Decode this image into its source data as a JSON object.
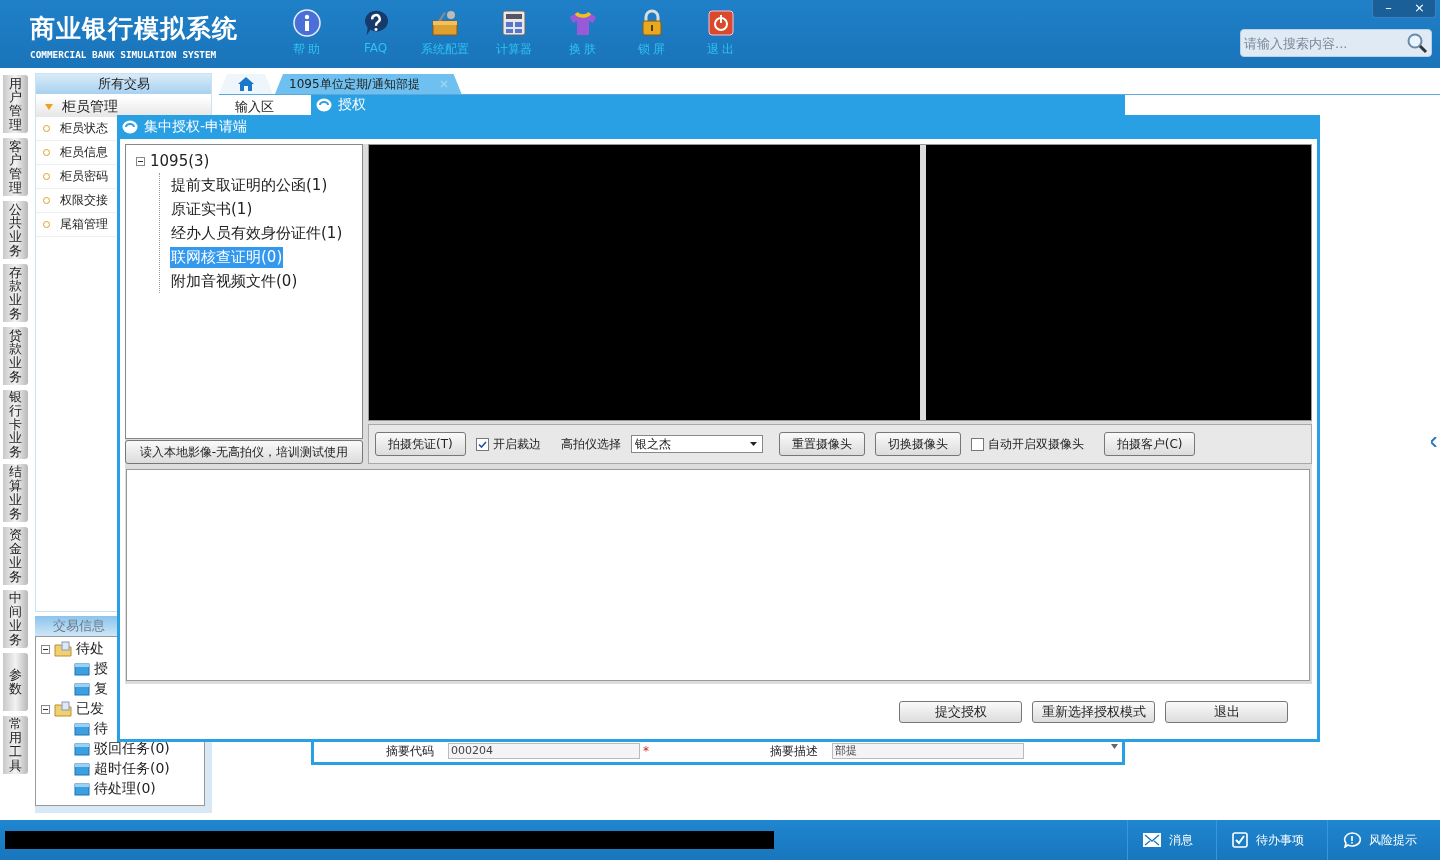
{
  "header": {
    "title": "商业银行模拟系统",
    "subtitle": "COMMERCIAL BANK SIMULATION SYSTEM",
    "tools": [
      {
        "label": "帮 助",
        "kind": "info"
      },
      {
        "label": "FAQ",
        "kind": "question"
      },
      {
        "label": "系统配置",
        "kind": "toolbox"
      },
      {
        "label": "计算器",
        "kind": "calculator"
      },
      {
        "label": "换 肤",
        "kind": "shirt"
      },
      {
        "label": "锁 屏",
        "kind": "lock"
      },
      {
        "label": "退 出",
        "kind": "power"
      }
    ],
    "window_controls": [
      "–",
      "×"
    ],
    "search": {
      "placeholder": "请输入搜索内容..."
    }
  },
  "side_tabs": [
    "用户管理",
    "客户管理",
    "公共业务",
    "存款业务",
    "贷款业务",
    "银行卡业务",
    "结算业务",
    "资金业务",
    "中间业务",
    "参数",
    "常用工具"
  ],
  "left_panel": {
    "title": "所有交易",
    "group": {
      "label": "柜员管理",
      "expanded": true
    },
    "items": [
      "柜员状态",
      "柜员信息",
      "柜员密码",
      "权限交接",
      "尾箱管理"
    ]
  },
  "info_panel": {
    "title": "交易信息",
    "tree": [
      {
        "label": "待处",
        "children": [
          {
            "label": "授"
          },
          {
            "label": "复"
          }
        ]
      },
      {
        "label": "已发",
        "children": [
          {
            "label": "待"
          },
          {
            "label": "驳回任务(0)"
          },
          {
            "label": "超时任务(0)"
          },
          {
            "label": "待处理(0)"
          }
        ]
      }
    ]
  },
  "main_tabs": [
    {
      "kind": "home",
      "selected": false
    },
    {
      "kind": "page",
      "label": "1095单位定期/通知部提",
      "selected": true
    }
  ],
  "back_dialog": {
    "title": "授权",
    "section": "输入区",
    "fields": [
      {
        "label": "摘要代码",
        "value": "000204",
        "mark": "*"
      },
      {
        "label": "摘要描述",
        "value": "部提"
      }
    ]
  },
  "front_dialog": {
    "title": "集中授权-申请端",
    "tree": {
      "label": "1095(3)",
      "expanded": true,
      "children": [
        {
          "label": "提前支取证明的公函(1)",
          "selected": false
        },
        {
          "label": "原证实书(1)",
          "selected": false
        },
        {
          "label": "经办人员有效身份证件(1)",
          "selected": false
        },
        {
          "label": "联网核查证明(0)",
          "selected": true
        },
        {
          "label": "附加音视频文件(0)",
          "selected": false
        }
      ]
    },
    "load_button": "读入本地影像-无高拍仪，培训测试使用",
    "toolbar": [
      {
        "kind": "button",
        "label": "拍摄凭证(T)"
      },
      {
        "kind": "checkbox",
        "label": "开启裁边",
        "checked": true
      },
      {
        "kind": "select",
        "label": "高拍仪选择",
        "value": "银之杰"
      },
      {
        "kind": "button",
        "label": "重置摄像头"
      },
      {
        "kind": "button",
        "label": "切换摄像头"
      },
      {
        "kind": "checkbox",
        "label": "自动开启双摄像头",
        "checked": false
      },
      {
        "kind": "button",
        "label": "拍摄客户(C)"
      }
    ],
    "buttons": [
      "提交授权",
      "重新选择授权模式",
      "退出"
    ]
  },
  "status_bar": {
    "items": [
      {
        "label": "消息",
        "kind": "mail"
      },
      {
        "label": "待办事项",
        "kind": "check"
      },
      {
        "label": "风险提示",
        "kind": "chat"
      }
    ]
  }
}
